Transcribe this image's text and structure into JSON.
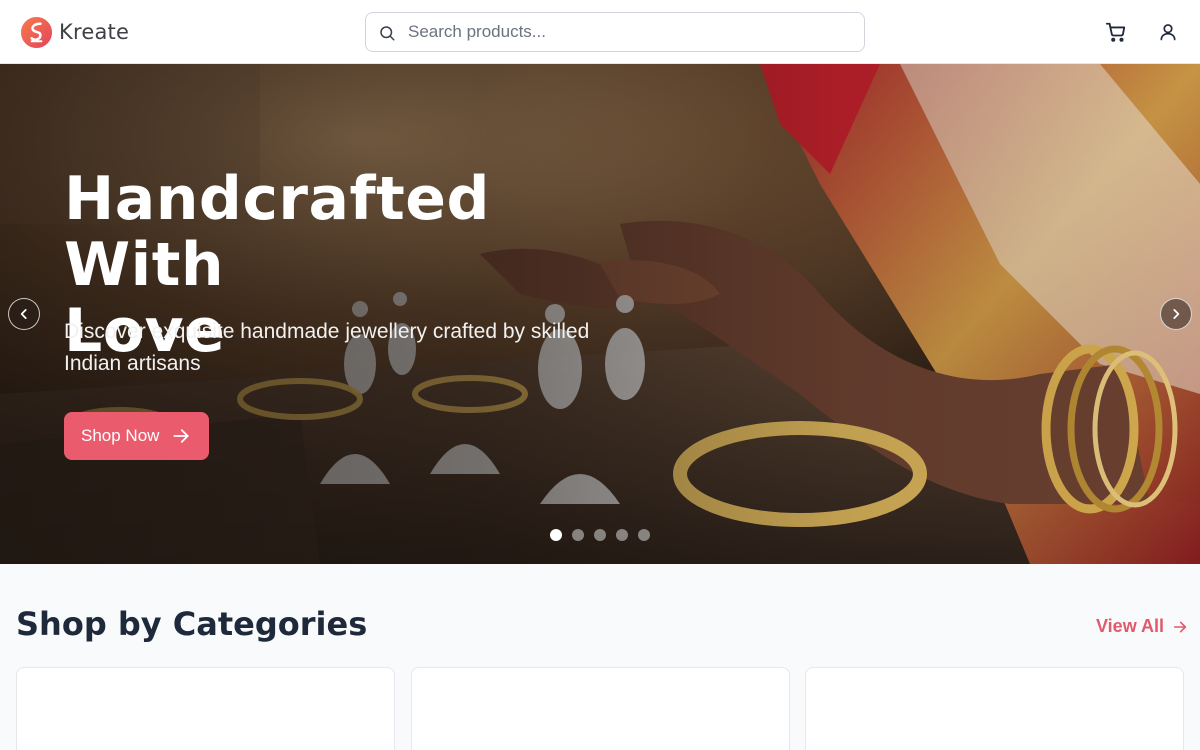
{
  "brand": {
    "name": "Kreate",
    "accent": "#ea5b6e"
  },
  "search": {
    "placeholder": "Search products..."
  },
  "header_icons": [
    "cart-icon",
    "user-icon"
  ],
  "hero": {
    "title_line1": "Handcrafted With",
    "title_line2": "Love",
    "subtitle": "Discover exquisite handmade jewellery crafted by skilled Indian artisans",
    "cta_label": "Shop Now",
    "slides_total": 5,
    "active_slide": 1
  },
  "categories": {
    "title": "Shop by Categories",
    "view_all_label": "View All",
    "cards_visible": 3
  }
}
